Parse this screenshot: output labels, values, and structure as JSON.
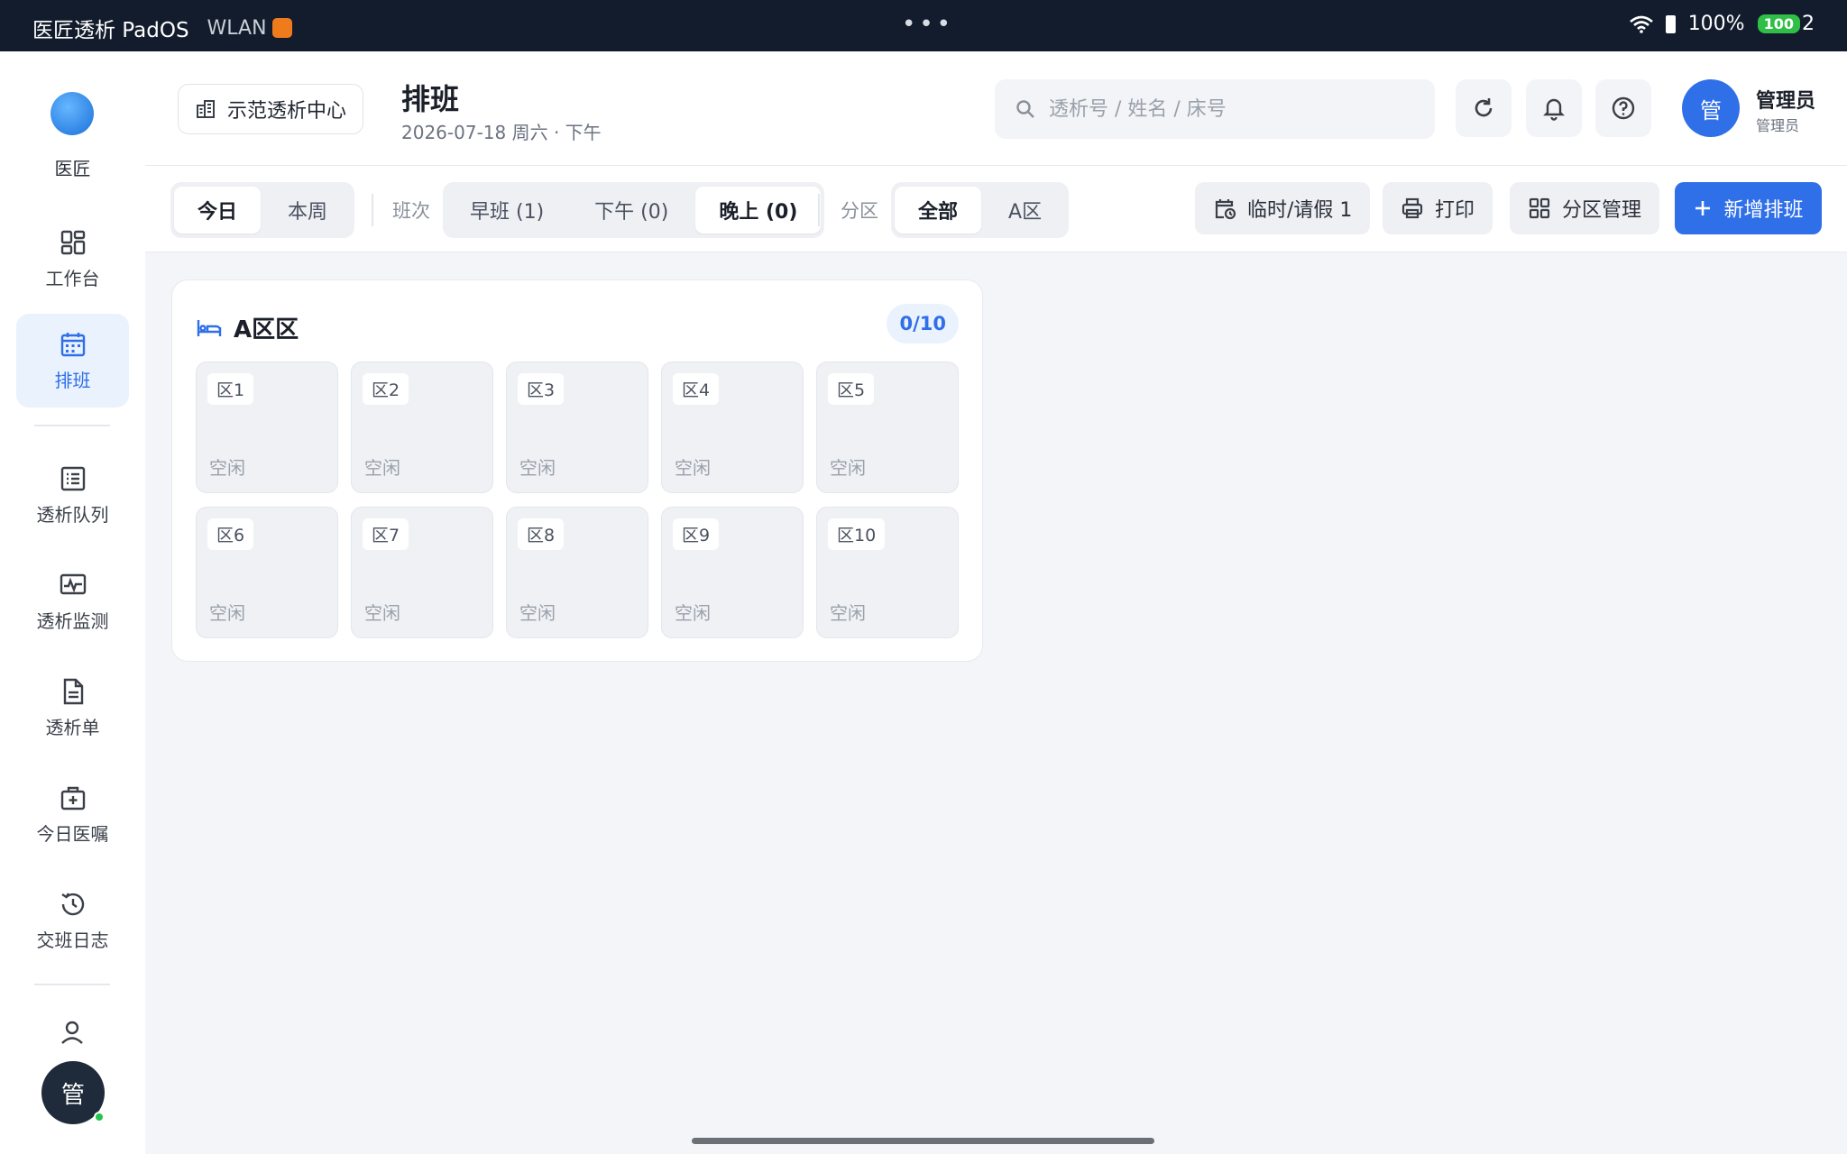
{
  "status_bar": {
    "app_name": "医匠透析 PadOS",
    "wlan": "WLAN",
    "more": "•••",
    "battery_percent": "100%",
    "battery_badge": "100",
    "trail": "2"
  },
  "sidebar": {
    "logo_label": "医匠",
    "items": [
      {
        "label": "工作台",
        "icon": "dashboard-icon"
      },
      {
        "label": "排班",
        "icon": "calendar-icon",
        "active": true
      },
      {
        "label": "透析队列",
        "icon": "list-icon"
      },
      {
        "label": "透析监测",
        "icon": "monitor-icon"
      },
      {
        "label": "透析单",
        "icon": "document-icon"
      },
      {
        "label": "今日医嘱",
        "icon": "medical-kit-icon"
      },
      {
        "label": "交班日志",
        "icon": "history-icon"
      }
    ],
    "user_initial": "管"
  },
  "header": {
    "center_name": "示范透析中心",
    "title": "排班",
    "subtitle": "2026-07-18 周六 · 下午",
    "search_placeholder": "透析号 / 姓名 / 床号",
    "user_initial": "管",
    "user_name": "管理员",
    "user_role": "管理员"
  },
  "toolbar": {
    "range_tabs": [
      {
        "label": "今日",
        "active": true
      },
      {
        "label": "本周",
        "active": false
      }
    ],
    "shift_label": "班次",
    "shift_tabs": [
      {
        "label": "早班 (1)",
        "active": false
      },
      {
        "label": "下午 (0)",
        "active": false
      },
      {
        "label": "晚上 (0)",
        "active": true
      }
    ],
    "zone_label": "分区",
    "zone_tabs": [
      {
        "label": "全部",
        "active": true
      },
      {
        "label": "A区",
        "active": false
      }
    ],
    "leave_btn": "临时/请假 1",
    "print_btn": "打印",
    "zone_manage_btn": "分区管理",
    "add_btn": "新增排班"
  },
  "zone": {
    "title": "A区区",
    "count": "0/10",
    "beds": [
      {
        "tag": "区1",
        "status": "空闲"
      },
      {
        "tag": "区2",
        "status": "空闲"
      },
      {
        "tag": "区3",
        "status": "空闲"
      },
      {
        "tag": "区4",
        "status": "空闲"
      },
      {
        "tag": "区5",
        "status": "空闲"
      },
      {
        "tag": "区6",
        "status": "空闲"
      },
      {
        "tag": "区7",
        "status": "空闲"
      },
      {
        "tag": "区8",
        "status": "空闲"
      },
      {
        "tag": "区9",
        "status": "空闲"
      },
      {
        "tag": "区10",
        "status": "空闲"
      }
    ]
  },
  "colors": {
    "accent": "#2f6fe8",
    "sidebar_active_bg": "#eaf2fe",
    "status_bar_bg": "#121c2c",
    "idle_text": "#9aa1ab"
  }
}
